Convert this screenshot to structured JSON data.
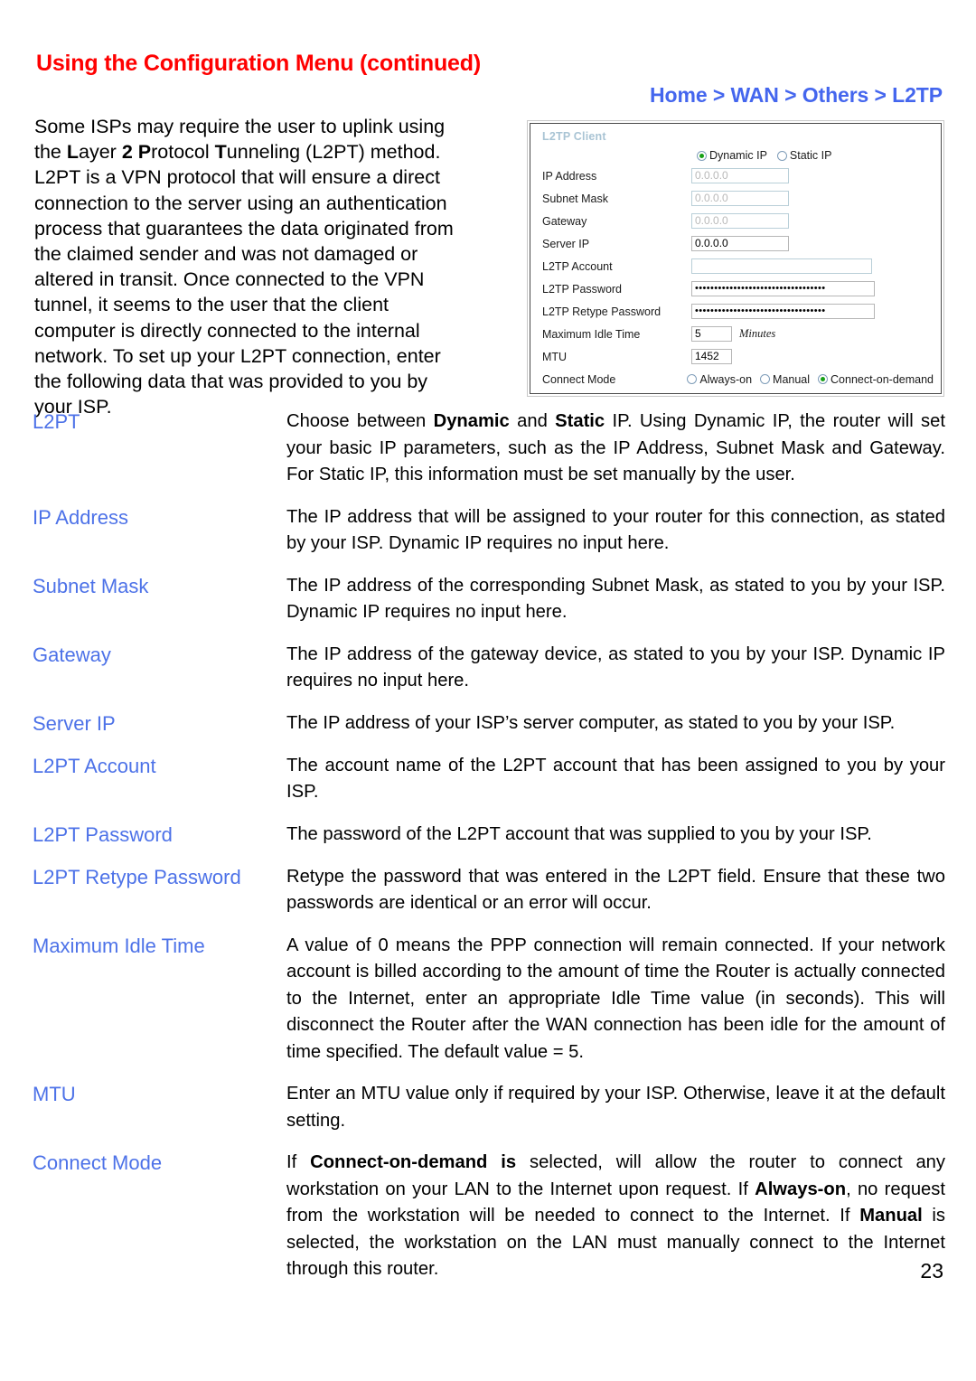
{
  "header": {
    "title": "Using the Configuration Menu (continued)",
    "breadcrumb": "Home > WAN > Others > L2TP",
    "title_color": "#ff0000",
    "breadcrumb_color": "#4466ee"
  },
  "intro": {
    "line1": "Some ISPs may require the user to uplink using",
    "line2_pre": "the ",
    "line2_b1": "L",
    "line2_m1": "ayer ",
    "line2_b2": "2",
    "line2_m2": " ",
    "line2_b3": "P",
    "line2_m3": "rotocol ",
    "line2_b4": "T",
    "line2_m4": "unneling (L2PT) method.",
    "line3": "L2PT is a VPN protocol that will ensure a direct",
    "line4": "connection to the server using an authentication",
    "line5": "process that guarantees the data originated from",
    "line6": "the claimed sender and was not damaged or",
    "line7": "altered in transit. Once connected to the VPN",
    "line8": "tunnel, it seems to the user that the client",
    "line9": "computer is directly connected to the internal",
    "line10": "network. To set up your L2PT connection, enter",
    "line11": "the following data that was provided to you by",
    "line12": "your ISP."
  },
  "panel": {
    "title": "L2TP Client",
    "title_color": "#a9c4d4",
    "ip_mode": {
      "options": [
        "Dynamic IP",
        "Static IP"
      ],
      "selected": "Dynamic IP"
    },
    "fields": [
      {
        "label": "IP Address",
        "value": "0.0.0.0",
        "disabled": true,
        "type": "ip"
      },
      {
        "label": "Subnet Mask",
        "value": "0.0.0.0",
        "disabled": true,
        "type": "ip"
      },
      {
        "label": "Gateway",
        "value": "0.0.0.0",
        "disabled": true,
        "type": "ip"
      },
      {
        "label": "Server IP",
        "value": "0.0.0.0",
        "disabled": false,
        "type": "ip"
      },
      {
        "label": "L2TP Account",
        "value": "",
        "disabled": false,
        "type": "account"
      },
      {
        "label": "L2TP Password",
        "value": "••••••••••••••••••••••••••••••••••",
        "disabled": false,
        "type": "password"
      },
      {
        "label": "L2TP Retype Password",
        "value": "••••••••••••••••••••••••••••••••••",
        "disabled": false,
        "type": "password"
      }
    ],
    "idle_time": {
      "label": "Maximum Idle Time",
      "value": "5",
      "unit": "Minutes"
    },
    "mtu": {
      "label": "MTU",
      "value": "1452"
    },
    "connect_mode": {
      "label": "Connect Mode",
      "options": [
        "Always-on",
        "Manual",
        "Connect-on-demand"
      ],
      "selected": "Connect-on-demand"
    },
    "radio_selected_color": "#17a017"
  },
  "definitions": [
    {
      "term": "L2PT",
      "desc_parts": [
        {
          "t": "Choose between ",
          "b": false
        },
        {
          "t": "Dynamic",
          "b": true
        },
        {
          "t": " and ",
          "b": false
        },
        {
          "t": "Static",
          "b": true
        },
        {
          "t": " IP. Using Dynamic IP, the router will set your basic IP parameters, such as the IP Address, Subnet Mask and Gateway. For Static IP, this information must be set manually by the user.",
          "b": false
        }
      ]
    },
    {
      "term": "IP Address",
      "desc_parts": [
        {
          "t": "The IP address that will be assigned to your router for this connection, as stated by your ISP. Dynamic IP requires no input here.",
          "b": false
        }
      ]
    },
    {
      "term": "Subnet Mask",
      "desc_parts": [
        {
          "t": "The IP address of the corresponding Subnet Mask, as stated to you by your ISP. Dynamic IP requires no input here.",
          "b": false
        }
      ]
    },
    {
      "term": "Gateway",
      "desc_parts": [
        {
          "t": "The IP address of the gateway device, as stated to you by your ISP. Dynamic IP requires no input here.",
          "b": false
        }
      ]
    },
    {
      "term": "Server IP",
      "desc_parts": [
        {
          "t": "The IP address of your ISP’s server computer, as stated to you by your ISP.",
          "b": false
        }
      ]
    },
    {
      "term": "L2PT Account",
      "desc_parts": [
        {
          "t": "The account name of the L2PT account that has been assigned to you by your ISP.",
          "b": false
        }
      ]
    },
    {
      "term": "L2PT Password",
      "desc_parts": [
        {
          "t": "The password of the L2PT account that was supplied to you by your ISP.",
          "b": false
        }
      ]
    },
    {
      "term": "L2PT Retype Password",
      "desc_parts": [
        {
          "t": "Retype the password that was entered in the L2PT field. Ensure that these two passwords are identical or an error will occur.",
          "b": false
        }
      ]
    },
    {
      "term": "Maximum Idle Time",
      "desc_parts": [
        {
          "t": "A value of 0 means the PPP connection will remain connected. If your network account is billed according to the amount of time the Router is actually connected to the Internet, enter an appropriate Idle Time value (in seconds). This will disconnect the Router after the WAN connection has been idle for the amount of time specified. The default value = 5.",
          "b": false
        }
      ]
    },
    {
      "term": "MTU",
      "desc_parts": [
        {
          "t": "Enter an MTU value only if required by your ISP. Otherwise, leave it at the default setting.",
          "b": false
        }
      ]
    },
    {
      "term": "Connect Mode",
      "desc_parts": [
        {
          "t": "If ",
          "b": false
        },
        {
          "t": "Connect-on-demand is",
          "b": true
        },
        {
          "t": " selected, will allow the router to connect any workstation on your LAN to the Internet upon request. If ",
          "b": false
        },
        {
          "t": "Always-on",
          "b": true
        },
        {
          "t": ", no request from the workstation will be needed to connect to the Internet. If ",
          "b": false
        },
        {
          "t": "Manual",
          "b": true
        },
        {
          "t": " is selected, the workstation on the LAN must manually connect to the Internet through this router.",
          "b": false
        }
      ]
    }
  ],
  "footer": {
    "page_number": "23"
  }
}
